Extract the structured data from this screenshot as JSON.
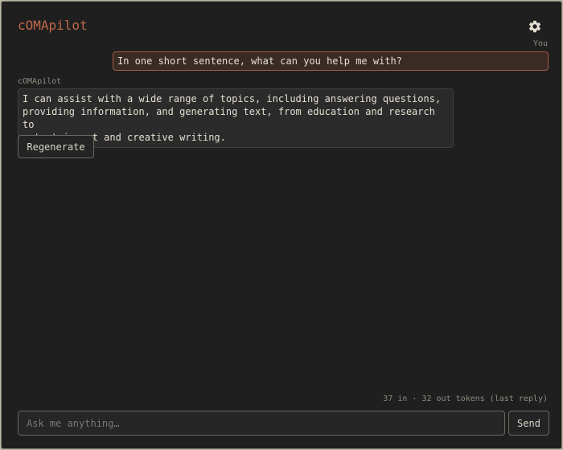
{
  "app": {
    "title": "cOMApilot",
    "settings_icon": "gear-icon",
    "accent_color": "#c0674a"
  },
  "conversation": {
    "user_label": "You",
    "user_message": "In one short sentence, what can you help me with?",
    "assistant_label": "cOMApilot",
    "assistant_message": "I can assist with a wide range of topics, including answering questions,\nproviding information, and generating text, from education and research to\nentertainment and creative writing.",
    "regenerate_label": "Regenerate"
  },
  "footer": {
    "token_stats": "37 in · 32 out tokens (last reply)",
    "input_placeholder": "Ask me anything…",
    "input_value": "",
    "send_label": "Send"
  }
}
